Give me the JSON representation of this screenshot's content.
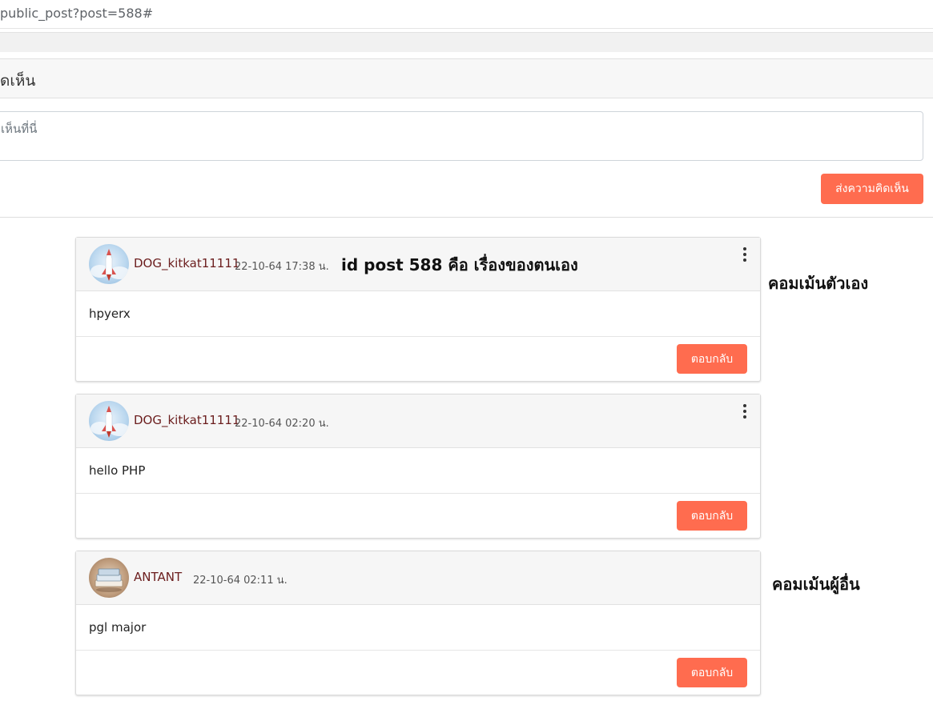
{
  "browser": {
    "url": "public_post?post=588#"
  },
  "comment_section": {
    "title": "ดเห็น",
    "input_placeholder": "เห็นที่นี่",
    "submit_label": "ส่งความคิดเห็น"
  },
  "comments": [
    {
      "author": "DOG_kitkat11111",
      "timestamp": "22-10-64 17:38 น.",
      "text": "hpyerx",
      "reply_label": "ตอบกลับ",
      "avatar_icon": "rocket-avatar-icon"
    },
    {
      "author": "DOG_kitkat11111",
      "timestamp": "22-10-64 02:20 น.",
      "text": "hello PHP",
      "reply_label": "ตอบกลับ",
      "avatar_icon": "rocket-avatar-icon"
    },
    {
      "author": "ANTANT",
      "timestamp": "22-10-64 02:11 น.",
      "text": "pgl major",
      "reply_label": "ตอบกลับ",
      "avatar_icon": "book-avatar-icon"
    }
  ],
  "annotations": {
    "post_id_note": "id post 588 คือ เรื่องของตนเอง",
    "own_comment_note": "คอมเม้นตัวเอง",
    "other_comment_note": "คอมเม้นผู้อื่น"
  },
  "colors": {
    "accent": "#ff6c4f",
    "author": "#6b1d1d"
  }
}
